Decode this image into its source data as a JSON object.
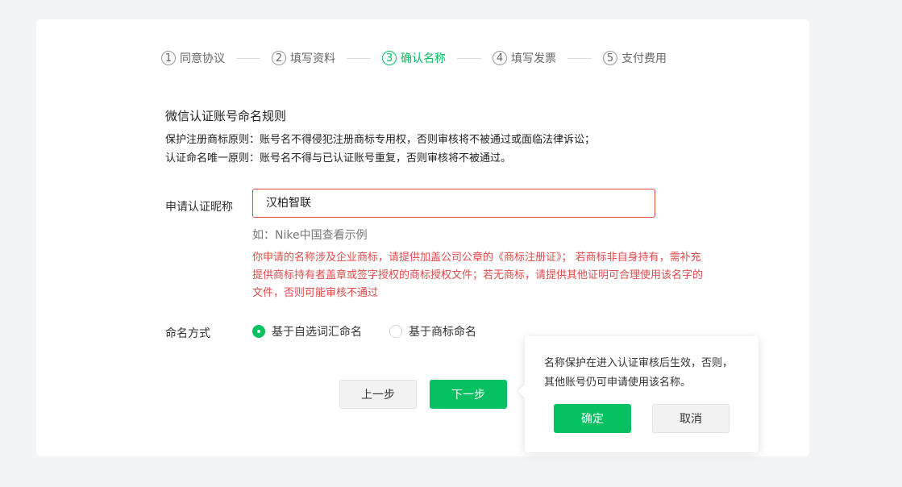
{
  "steps": [
    {
      "num": "1",
      "label": "同意协议"
    },
    {
      "num": "2",
      "label": "填写资料"
    },
    {
      "num": "3",
      "label": "确认名称"
    },
    {
      "num": "4",
      "label": "填写发票"
    },
    {
      "num": "5",
      "label": "支付费用"
    }
  ],
  "active_step": 3,
  "rules": {
    "title": "微信认证账号命名规则",
    "line1": "保护注册商标原则：账号名不得侵犯注册商标专用权，否则审核将不被通过或面临法律诉讼；",
    "line2": "认证命名唯一原则：账号名不得与已认证账号重复，否则审核将不被通过。"
  },
  "nickname": {
    "label": "申请认证昵称",
    "value": "汉柏智联",
    "example": "如：Nike中国查看示例",
    "warning": "你申请的名称涉及企业商标，请提供加盖公司公章的《商标注册证》； 若商标非自身持有，需补充提供商标持有者盖章或签字授权的商标授权文件；若无商标，请提供其他证明可合理使用该名字的文件，否则可能审核不通过"
  },
  "naming_method": {
    "label": "命名方式",
    "options": [
      "基于自选词汇命名",
      "基于商标命名"
    ],
    "selected": "基于自选词汇命名"
  },
  "buttons": {
    "prev": "上一步",
    "next": "下一步"
  },
  "popover": {
    "text": "名称保护在进入认证审核后生效，否则，其他账号仍可申请使用该名称。",
    "confirm": "确定",
    "cancel": "取消"
  },
  "colors": {
    "accent": "#07c160",
    "error": "#e24b4b"
  }
}
